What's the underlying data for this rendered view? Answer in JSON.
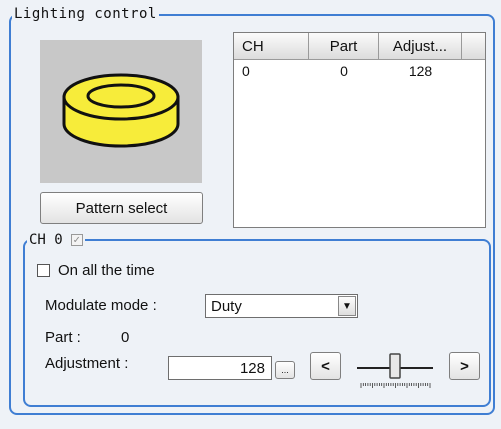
{
  "group": {
    "title": "Lighting control",
    "pattern_button": "Pattern select"
  },
  "table": {
    "columns": [
      "CH",
      "Part",
      "Adjust..."
    ],
    "rows": [
      [
        "0",
        "0",
        "128"
      ]
    ]
  },
  "channel": {
    "title": "CH 0",
    "always_on_label": "On all the time",
    "modulate_label": "Modulate mode :",
    "modulate_value": "Duty",
    "part_label": "Part :",
    "part_value": "0",
    "adjustment_label": "Adjustment :",
    "adjustment_value": "128",
    "ellipsis_label": "...",
    "decrease_label": "<",
    "increase_label": ">",
    "slider_level": 0.5
  },
  "colors": {
    "accent": "#3f7ed3",
    "ring": "#f7ec3a",
    "preview_bg": "#c8c8c8"
  }
}
